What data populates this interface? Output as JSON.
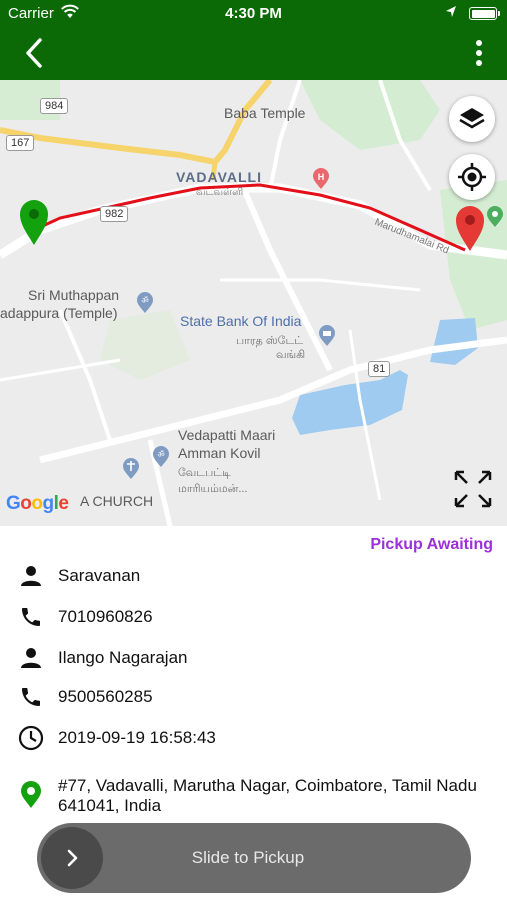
{
  "status_bar": {
    "carrier": "Carrier",
    "time": "4:30 PM"
  },
  "nav": {
    "back_icon": "chevron-left-icon",
    "menu_icon": "more-vertical-icon"
  },
  "map": {
    "labels": {
      "baba_temple": "Baba Temple",
      "vadavalli": "VADAVALLI",
      "vadavalli_tamil": "வடவள்ளி",
      "sri_muthappan_1": "Sri Muthappan",
      "sri_muthappan_2": "adappura (Temple)",
      "sbi": "State Bank Of India",
      "sbi_tamil_1": "பாரத ஸ்டேட்",
      "sbi_tamil_2": "வங்கி",
      "vedapatti_1": "Vedapatti Maari",
      "vedapatti_2": "Amman Kovil",
      "vedapatti_tamil_1": "வேடபட்டி",
      "vedapatti_tamil_2": "மாரியம்மன்...",
      "church": "A CHURCH",
      "marudhamalai_rd": "Marudhamalai Rd",
      "road_984": "984",
      "road_167": "167",
      "road_982": "982",
      "road_81": "81"
    },
    "google_logo": "Google",
    "route_color": "#e3101a",
    "pickup_pin_color": "#13a10e",
    "drop_pin_color": "#e53935"
  },
  "ride": {
    "status": "Pickup Awaiting",
    "status_color": "#9b30d9",
    "rider_name": "Saravanan",
    "rider_phone": "7010960826",
    "driver_name": "Ilango Nagarajan",
    "driver_phone": "9500560285",
    "datetime": "2019-09-19 16:58:43",
    "address": "#77, Vadavalli, Marutha Nagar, Coimbatore, Tamil Nadu 641041, India"
  },
  "slider": {
    "label": "Slide to Pickup"
  }
}
